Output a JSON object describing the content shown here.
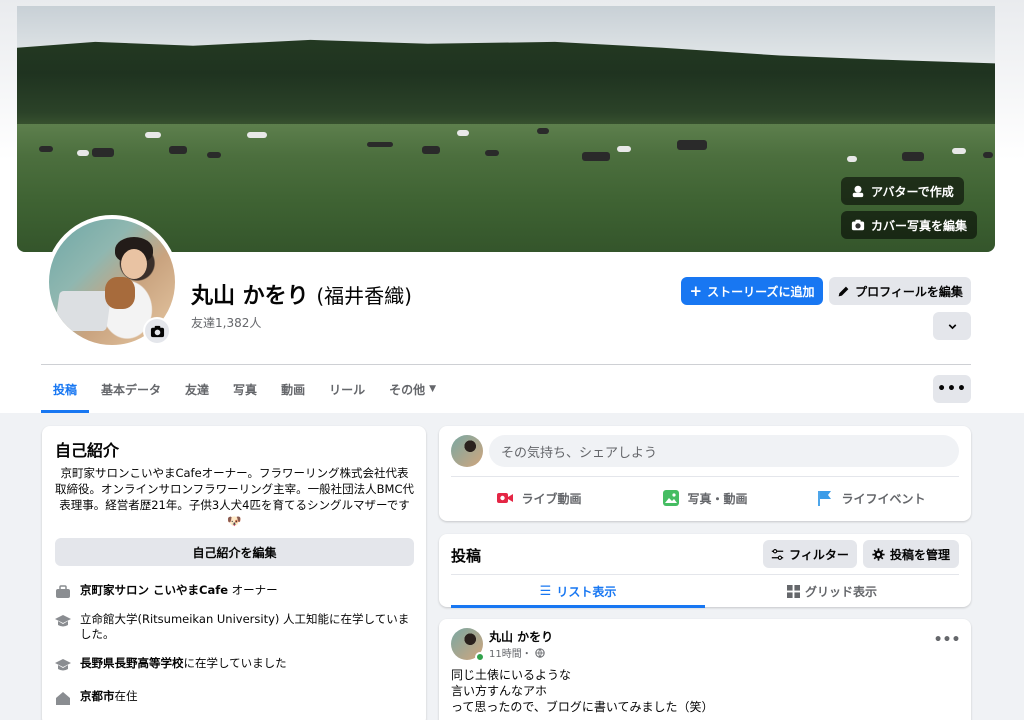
{
  "cover": {
    "avatar_button": "アバターで作成",
    "edit_cover_button": "カバー写真を編集"
  },
  "profile": {
    "name": "丸山 かをり",
    "alternate_name": "(福井香織)",
    "friends": "友達1,382人"
  },
  "actions": {
    "add_story": "ストーリーズに追加",
    "edit_profile": "プロフィールを編集"
  },
  "tabs": [
    {
      "label": "投稿"
    },
    {
      "label": "基本データ"
    },
    {
      "label": "友達"
    },
    {
      "label": "写真"
    },
    {
      "label": "動画"
    },
    {
      "label": "リール"
    },
    {
      "label": "その他"
    }
  ],
  "intro": {
    "title": "自己紹介",
    "bio": "京町家サロンこいやまCafeオーナー。フラワーリング株式会社代表取締役。オンラインサロンフラワーリング主宰。一般社団法人BMC代表理事。経営者歴21年。子供3人犬4匹を育てるシングルマザーです🐶",
    "edit_button": "自己紹介を編集",
    "work": {
      "place": "京町家サロン こいやまCafe",
      "suffix": " オーナー"
    },
    "university": {
      "text": "立命館大学(Ritsumeikan University) 人工知能に在学していました。"
    },
    "highschool": {
      "place": "長野県長野高等学校",
      "suffix": "に在学していました"
    },
    "city": {
      "place": "京都市",
      "suffix": "在住"
    }
  },
  "composer": {
    "placeholder": "その気持ち、シェアしよう",
    "live": "ライブ動画",
    "photo": "写真・動画",
    "event": "ライフイベント"
  },
  "posts": {
    "title": "投稿",
    "filter_button": "フィルター",
    "manage_button": "投稿を管理",
    "list_view": "リスト表示",
    "grid_view": "グリッド表示"
  },
  "post": {
    "author": "丸山 かをり",
    "time": "11時間・",
    "lines": [
      "同じ土俵にいるような",
      "言い方すんなアホ",
      "って思ったので、ブログに書いてみました（笑）"
    ]
  },
  "colors": {
    "accent": "#1877f2",
    "page_bg": "#f0f2f5",
    "secondary_text": "#65676b",
    "button_grey": "#e4e6eb"
  }
}
